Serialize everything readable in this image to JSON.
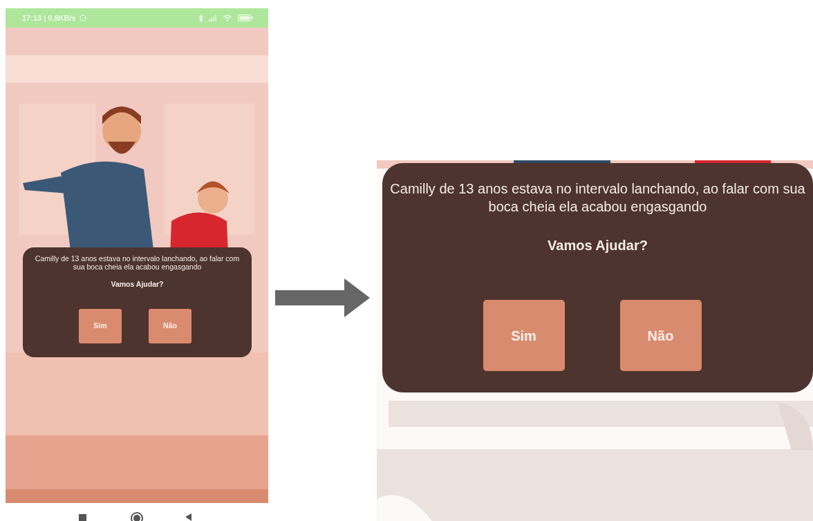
{
  "phone": {
    "status_bar": {
      "text": "17:13 | 0,8KB/s"
    },
    "dialog": {
      "message": "Camilly de 13 anos estava no intervalo lanchando, ao falar com sua boca cheia ela acabou engasgando",
      "question": "Vamos Ajudar?",
      "buttons": [
        {
          "label": "Sim"
        },
        {
          "label": "Não"
        }
      ]
    }
  },
  "zoomed_view": {
    "dialog": {
      "message": "Camilly de 13 anos estava no intervalo lanchando, ao falar com sua boca cheia ela acabou engasgando",
      "question": "Vamos Ajudar?",
      "buttons": [
        {
          "label": "Sim"
        },
        {
          "label": "Não"
        }
      ]
    }
  }
}
